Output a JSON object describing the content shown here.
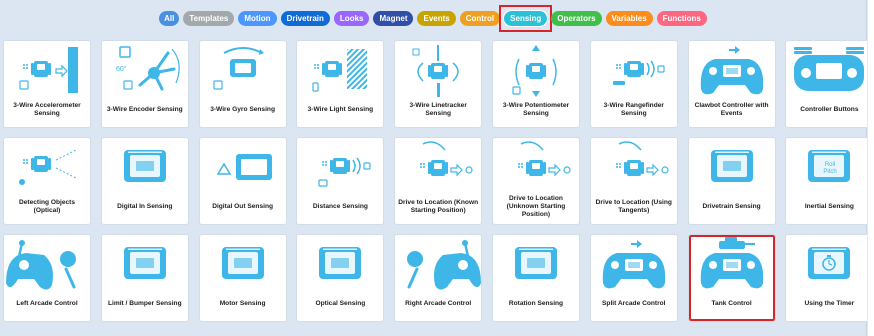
{
  "filters": [
    {
      "label": "All",
      "color": "#4a90e2"
    },
    {
      "label": "Templates",
      "color": "#a3a8ad"
    },
    {
      "label": "Motion",
      "color": "#4c97ff"
    },
    {
      "label": "Drivetrain",
      "color": "#0f6bd6"
    },
    {
      "label": "Looks",
      "color": "#9966ff"
    },
    {
      "label": "Magnet",
      "color": "#2f4fa8"
    },
    {
      "label": "Events",
      "color": "#c8a400"
    },
    {
      "label": "Control",
      "color": "#f0a020"
    },
    {
      "label": "Sensing",
      "color": "#2bc2d8"
    },
    {
      "label": "Operators",
      "color": "#40bf4a"
    },
    {
      "label": "Variables",
      "color": "#ff8c1a"
    },
    {
      "label": "Functions",
      "color": "#ff6680"
    }
  ],
  "selected_filter": "Sensing",
  "cards": [
    {
      "label": "3-Wire Accelerometer Sensing",
      "icon": "accelerometer-icon"
    },
    {
      "label": "3-Wire Encoder Sensing",
      "icon": "encoder-icon"
    },
    {
      "label": "3-Wire Gyro Sensing",
      "icon": "gyro-icon"
    },
    {
      "label": "3-Wire Light Sensing",
      "icon": "light-sensor-icon"
    },
    {
      "label": "3-Wire Linetracker Sensing",
      "icon": "linetracker-icon"
    },
    {
      "label": "3-Wire Potentiometer Sensing",
      "icon": "potentiometer-icon"
    },
    {
      "label": "3-Wire Rangefinder Sensing",
      "icon": "rangefinder-icon"
    },
    {
      "label": "Clawbot Controller with Events",
      "icon": "controller-icon"
    },
    {
      "label": "Controller Buttons",
      "icon": "controller-buttons-icon"
    },
    {
      "label": "Detecting Objects (Optical)",
      "icon": "optical-sensor-icon"
    },
    {
      "label": "Digital In Sensing",
      "icon": "brain-screen-icon"
    },
    {
      "label": "Digital Out Sensing",
      "icon": "digital-out-icon"
    },
    {
      "label": "Distance Sensing",
      "icon": "distance-sensor-icon"
    },
    {
      "label": "Drive to Location (Known Starting Position)",
      "icon": "gps-icon"
    },
    {
      "label": "Drive to Location (Unknown Starting Position)",
      "icon": "gps-icon"
    },
    {
      "label": "Drive to Location (Using Tangents)",
      "icon": "gps-icon"
    },
    {
      "label": "Drivetrain Sensing",
      "icon": "brain-screen-icon"
    },
    {
      "label": "Inertial Sensing",
      "icon": "inertial-icon"
    },
    {
      "label": "Left Arcade Control",
      "icon": "arcade-left-icon"
    },
    {
      "label": "Limit / Bumper Sensing",
      "icon": "brain-screen-icon"
    },
    {
      "label": "Motor Sensing",
      "icon": "brain-screen-icon"
    },
    {
      "label": "Optical Sensing",
      "icon": "brain-screen-icon"
    },
    {
      "label": "Right Arcade Control",
      "icon": "arcade-right-icon"
    },
    {
      "label": "Rotation Sensing",
      "icon": "brain-screen-icon"
    },
    {
      "label": "Split Arcade Control",
      "icon": "controller-icon"
    },
    {
      "label": "Tank Control",
      "icon": "tank-controller-icon"
    },
    {
      "label": "Using the Timer",
      "icon": "timer-icon"
    }
  ],
  "highlighted_card": "Tank Control",
  "accent_color": "#3fb6e8"
}
